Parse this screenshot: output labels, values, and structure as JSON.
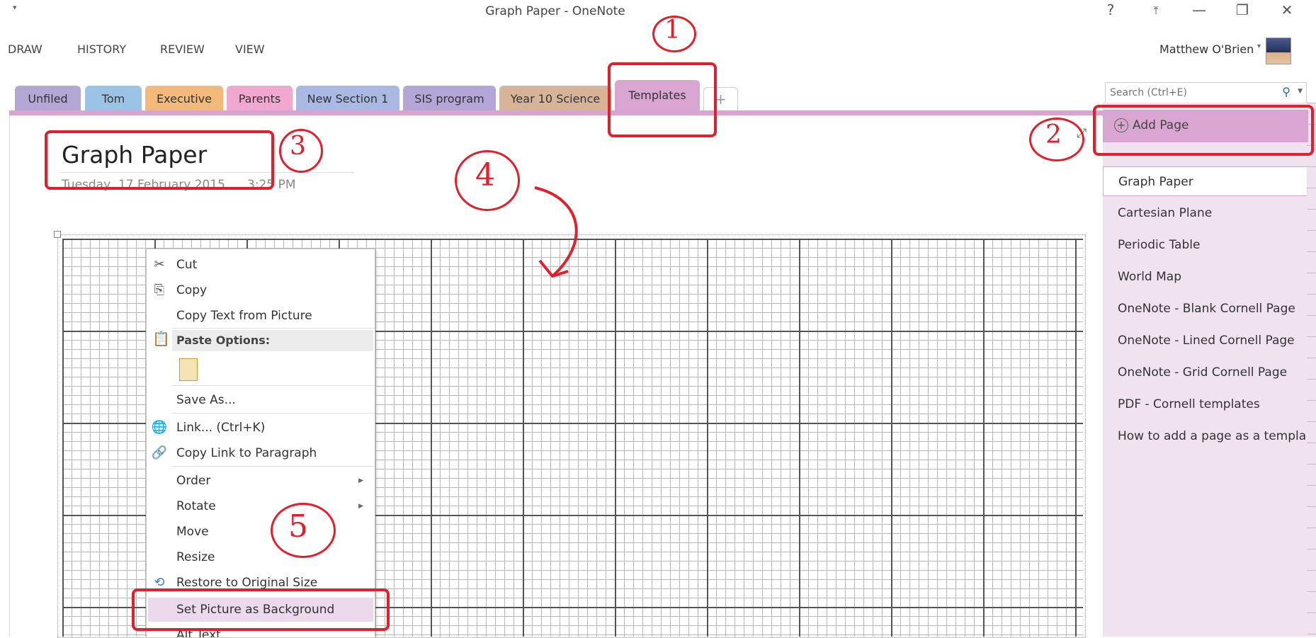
{
  "window": {
    "title": "Graph Paper - OneNote",
    "controls": [
      "?",
      "⤒",
      "—",
      "❐",
      "✕"
    ]
  },
  "ribbon": {
    "tabs": [
      "DRAW",
      "HISTORY",
      "REVIEW",
      "VIEW"
    ],
    "user_name": "Matthew O'Brien"
  },
  "sections": [
    {
      "label": "Unfiled",
      "color": "#b3a7d6"
    },
    {
      "label": "Tom",
      "color": "#9bc3e6"
    },
    {
      "label": "Executive",
      "color": "#f2b97a"
    },
    {
      "label": "Parents",
      "color": "#f0a7d0"
    },
    {
      "label": "New Section 1",
      "color": "#a9b9e3"
    },
    {
      "label": "SIS program",
      "color": "#b4a7d8"
    },
    {
      "label": "Year 10 Science",
      "color": "#d7b497"
    },
    {
      "label": "Templates",
      "color": "#d9a5d1"
    }
  ],
  "add_section_label": "+",
  "search": {
    "placeholder": "Search (Ctrl+E)"
  },
  "page": {
    "title": "Graph Paper",
    "date": "Tuesday, 17 February 2015",
    "time": "3:25 PM"
  },
  "pages_panel": {
    "add_page_label": "Add Page",
    "pages": [
      "Graph Paper",
      "Cartesian Plane",
      "Periodic Table",
      "World Map",
      "OneNote - Blank Cornell Page",
      "OneNote - Lined Cornell Page",
      "OneNote - Grid Cornell Page",
      "PDF - Cornell templates",
      "How to add a page as a templa"
    ]
  },
  "context_menu": {
    "cut": "Cut",
    "copy": "Copy",
    "copy_text_from_picture": "Copy Text from Picture",
    "paste_options": "Paste Options:",
    "save_as": "Save As...",
    "link": "Link...  (Ctrl+K)",
    "copy_link": "Copy Link to Paragraph",
    "order": "Order",
    "rotate": "Rotate",
    "move": "Move",
    "resize": "Resize",
    "restore": "Restore to Original Size",
    "set_background": "Set Picture as Background",
    "alt_text": "Alt Text..."
  },
  "annotations": [
    "1",
    "2",
    "3",
    "4",
    "5"
  ]
}
